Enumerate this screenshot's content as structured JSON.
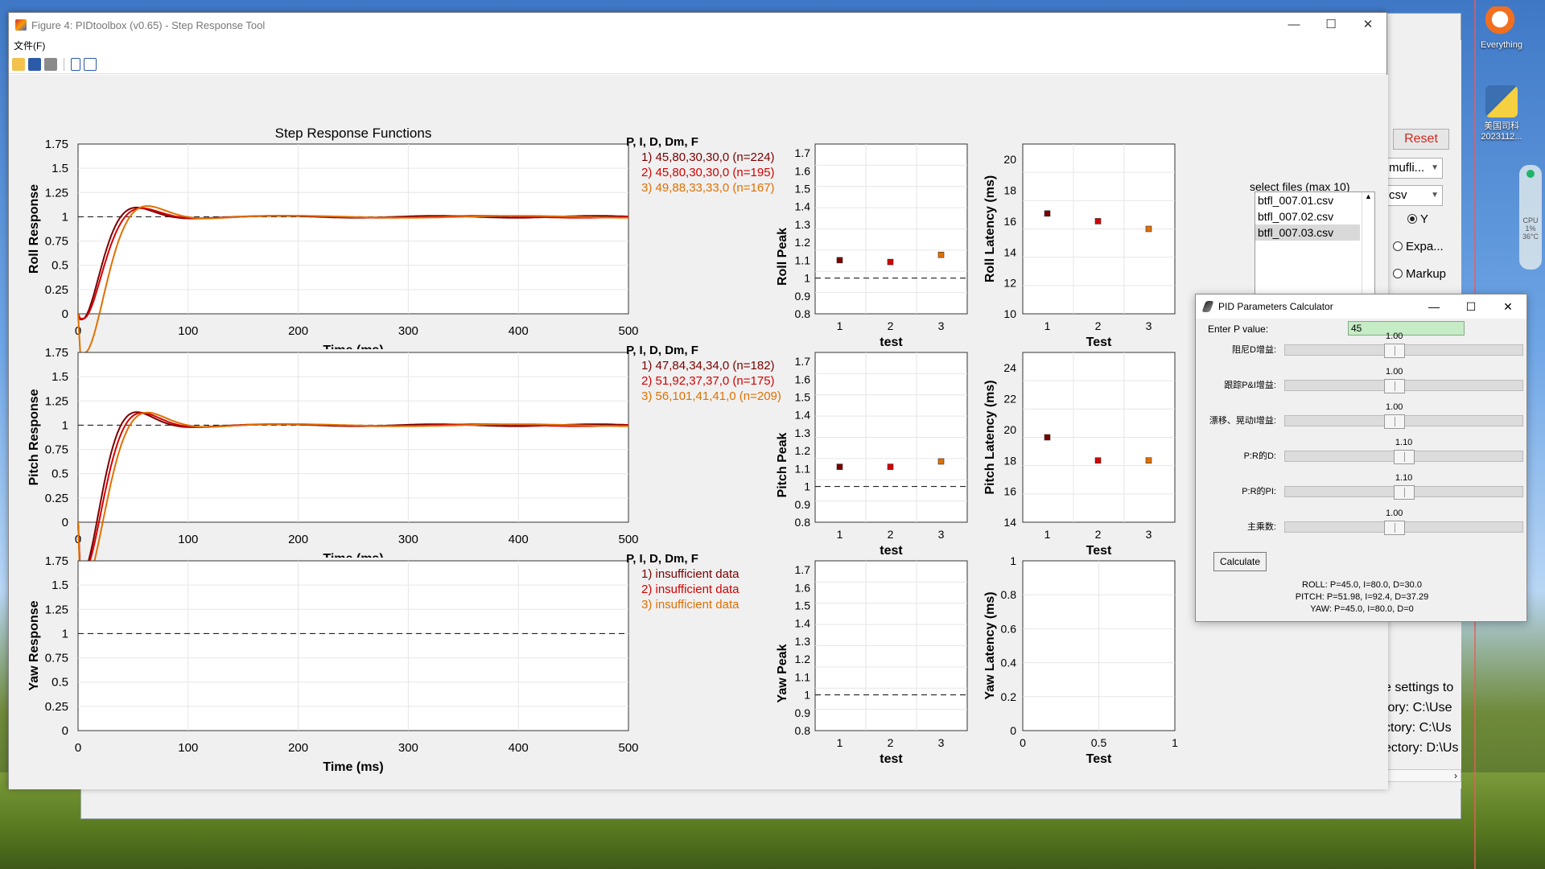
{
  "window": {
    "title": "Figure 4: PIDtoolbox (v0.65) - Step Response Tool",
    "menu_file": "文件(F)",
    "controls": {
      "min": "—",
      "max": "☐",
      "close": "✕"
    }
  },
  "figure": {
    "main_title": "Step Response Functions",
    "legend_header": "P, I, D, Dm, F",
    "roll_legend": [
      "1) 45,80,30,30,0  (n=224)",
      "2) 45,80,30,30,0  (n=195)",
      "3) 49,88,33,33,0  (n=167)"
    ],
    "pitch_legend": [
      "1) 47,84,34,34,0  (n=182)",
      "2) 51,92,37,37,0  (n=175)",
      "3) 56,101,41,41,0  (n=209)"
    ],
    "yaw_legend": [
      "1) insufficient data",
      "2) insufficient data",
      "3) insufficient data"
    ],
    "x_ticks": [
      "0",
      "100",
      "200",
      "300",
      "400",
      "500"
    ],
    "y_ticks": [
      "0",
      "0.25",
      "0.5",
      "0.75",
      "1",
      "1.25",
      "1.5",
      "1.75"
    ],
    "xlabel": "Time (ms)",
    "roll_ylabel": "Roll Response",
    "pitch_ylabel": "Pitch Response",
    "yaw_ylabel": "Yaw Response",
    "peak_y_ticks": [
      "0.8",
      "0.9",
      "1",
      "1.1",
      "1.2",
      "1.3",
      "1.4",
      "1.5",
      "1.6",
      "1.7"
    ],
    "peak_x_ticks": [
      "1",
      "2",
      "3"
    ],
    "peak_xlabel": "test",
    "roll_peak_ylabel": "Roll Peak",
    "pitch_peak_ylabel": "Pitch Peak",
    "yaw_peak_ylabel": "Yaw Peak",
    "roll_latency_y_ticks": [
      "10",
      "12",
      "14",
      "16",
      "18",
      "20"
    ],
    "pitch_latency_y_ticks": [
      "14",
      "16",
      "18",
      "20",
      "22",
      "24"
    ],
    "yaw_latency_y_ticks": [
      "0",
      "0.2",
      "0.4",
      "0.6",
      "0.8",
      "1"
    ],
    "latency_x_ticks": [
      "1",
      "2",
      "3"
    ],
    "yaw_latency_x_ticks": [
      "0",
      "0.5",
      "1"
    ],
    "latency_xlabel": "Test",
    "roll_latency_ylabel": "Roll Latency (ms)",
    "pitch_latency_ylabel": "Pitch Latency (ms)",
    "yaw_latency_ylabel": "Yaw Latency (ms)",
    "colors": {
      "s1": "#7a0000",
      "s2": "#d40000",
      "s3": "#e07000"
    }
  },
  "chart_data": [
    {
      "type": "line",
      "name": "roll-step-response",
      "xlabel": "Time (ms)",
      "ylabel": "Roll Response",
      "xlim": [
        0,
        500
      ],
      "ylim": [
        0,
        1.75
      ],
      "series_peaks": [
        1.09,
        1.09,
        1.12
      ],
      "reference_line": 1
    },
    {
      "type": "line",
      "name": "pitch-step-response",
      "xlabel": "Time (ms)",
      "ylabel": "Pitch Response",
      "xlim": [
        0,
        500
      ],
      "ylim": [
        0,
        1.75
      ],
      "series_peaks": [
        1.13,
        1.13,
        1.14
      ],
      "reference_line": 1
    },
    {
      "type": "scatter",
      "name": "roll-peak",
      "x": [
        1,
        2,
        3
      ],
      "y": [
        1.1,
        1.09,
        1.13
      ],
      "xlabel": "test",
      "ylabel": "Roll Peak",
      "ylim": [
        0.8,
        1.75
      ]
    },
    {
      "type": "scatter",
      "name": "pitch-peak",
      "x": [
        1,
        2,
        3
      ],
      "y": [
        1.11,
        1.11,
        1.14
      ],
      "xlabel": "test",
      "ylabel": "Pitch Peak",
      "ylim": [
        0.8,
        1.75
      ]
    },
    {
      "type": "scatter",
      "name": "roll-latency",
      "x": [
        1,
        2,
        3
      ],
      "y": [
        16.5,
        16.0,
        15.5
      ],
      "xlabel": "Test",
      "ylabel": "Roll Latency (ms)",
      "ylim": [
        10,
        21
      ]
    },
    {
      "type": "scatter",
      "name": "pitch-latency",
      "x": [
        1,
        2,
        3
      ],
      "y": [
        19.5,
        18.0,
        18.0
      ],
      "xlabel": "Test",
      "ylabel": "Pitch Latency (ms)",
      "ylim": [
        14,
        25
      ]
    }
  ],
  "files": {
    "group_label": "select files (max 10)",
    "items": [
      "btfl_007.01.csv",
      "btfl_007.02.csv",
      "btfl_007.03.csv"
    ],
    "selected_index": 2
  },
  "bg_panel": {
    "reset": "Reset",
    "combo1": "mufli...",
    "combo2": "csv",
    "radio_y": "Y",
    "radio_expa": "Expa...",
    "radio_markup": "Markup",
    "status": [
      "e settings to",
      "tory: C:\\Use",
      "ctory: C:\\Us",
      "ectory: D:\\Us"
    ]
  },
  "pid": {
    "title": "PID Parameters Calculator",
    "p_label": "Enter P value:",
    "p_value": "45",
    "sliders": [
      {
        "label": "阻尼D增益:",
        "value": "1.00",
        "pos": 0.42
      },
      {
        "label": "跟踪P&I增益:",
        "value": "1.00",
        "pos": 0.42
      },
      {
        "label": "漂移、晃动I增益:",
        "value": "1.00",
        "pos": 0.42
      },
      {
        "label": "P:R的D:",
        "value": "1.10",
        "pos": 0.46
      },
      {
        "label": "P:R的PI:",
        "value": "1.10",
        "pos": 0.46
      },
      {
        "label": "主乘数:",
        "value": "1.00",
        "pos": 0.42
      }
    ],
    "calculate": "Calculate",
    "roll": "ROLL: P=45.0, I=80.0, D=30.0",
    "pitch": "PITCH: P=51.98, I=92.4, D=37.29",
    "yaw": "YAW: P=45.0, I=80.0, D=0"
  },
  "desktop": {
    "everything": "Everything",
    "py_icon": "美国司科 2023112...",
    "cpu": "CPU",
    "cpu_pct": "1%",
    "temp": "36°C"
  }
}
